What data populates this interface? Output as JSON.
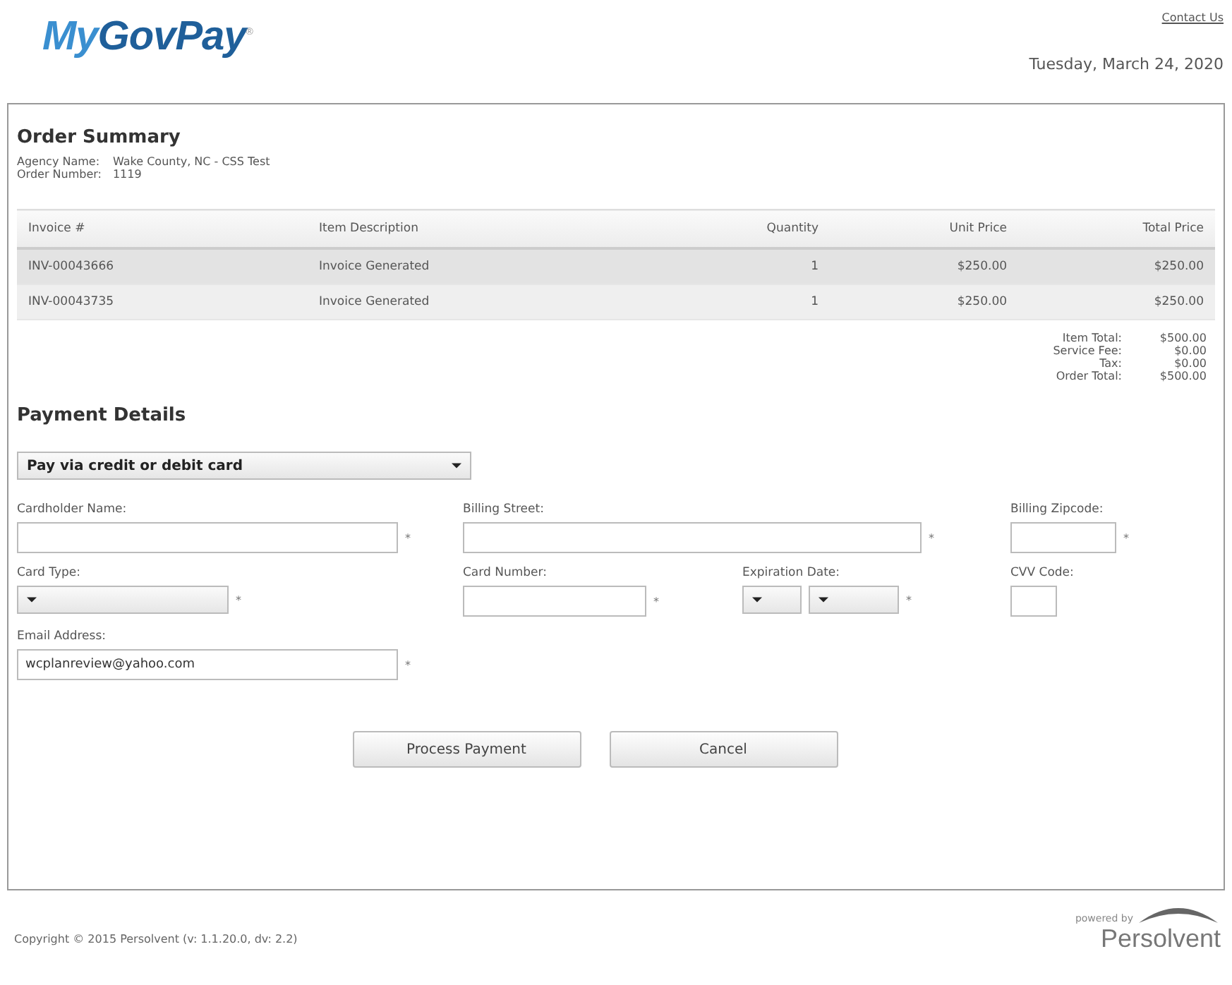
{
  "header": {
    "logo_first": "My",
    "logo_second": "GovPay",
    "logo_mark": "®",
    "contact_link": "Contact Us",
    "date": "Tuesday, March 24, 2020"
  },
  "order_summary": {
    "title": "Order Summary",
    "info": [
      {
        "label": "Agency Name:",
        "value": "Wake County, NC - CSS Test"
      },
      {
        "label": "Order Number:",
        "value": "1119"
      }
    ],
    "table": {
      "columns": [
        "Invoice #",
        "Item Description",
        "Quantity",
        "Unit Price",
        "Total Price"
      ],
      "rows": [
        [
          "INV-00043666",
          "Invoice Generated",
          "1",
          "$250.00",
          "$250.00"
        ],
        [
          "INV-00043735",
          "Invoice Generated",
          "1",
          "$250.00",
          "$250.00"
        ]
      ]
    },
    "totals": [
      {
        "label": "Item Total:",
        "value": "$500.00"
      },
      {
        "label": "Service Fee:",
        "value": "$0.00"
      },
      {
        "label": "Tax:",
        "value": "$0.00"
      },
      {
        "label": "Order Total:",
        "value": "$500.00"
      }
    ]
  },
  "payment_details": {
    "title": "Payment Details",
    "method": "Pay via credit or debit card",
    "form_rows": [
      [
        {
          "kind": "text",
          "label": "Cardholder Name:",
          "asterisk": "*"
        },
        {
          "kind": "text",
          "label": "Billing Street:",
          "asterisk": "*"
        },
        {
          "kind": "text",
          "label": "Billing Zipcode:",
          "asterisk": "*"
        }
      ],
      [
        {
          "kind": "select",
          "label": "Card Type:",
          "asterisk": "*"
        },
        {
          "kind": "text",
          "label": "Card Number:",
          "asterisk": "*"
        },
        {
          "kind": "select_pair",
          "label": "Expiration Date:",
          "asterisk": "*"
        },
        {
          "kind": "text",
          "label": "CVV Code:"
        }
      ],
      [
        {
          "kind": "text",
          "label": "Email Address:",
          "value": "wcplanreview@yahoo.com",
          "asterisk": "*"
        }
      ]
    ],
    "buttons": [
      "Process Payment",
      "Cancel"
    ]
  },
  "footer": {
    "copyright": "Copyright © 2015 Persolvent (v: 1.1.20.0, dv: 2.2)",
    "powered_by": "powered by",
    "brand": "Persolvent"
  }
}
